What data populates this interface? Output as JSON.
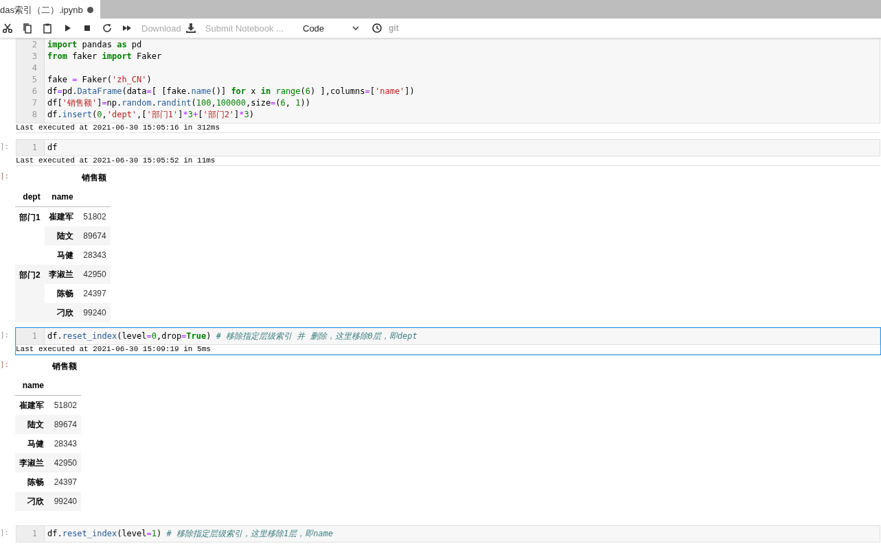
{
  "tab": {
    "title": "das索引（二）.ipynb",
    "unsaved": true
  },
  "toolbar": {
    "buttons": [
      {
        "kind": "cut"
      },
      {
        "kind": "copy"
      },
      {
        "kind": "paste"
      },
      {
        "kind": "run"
      },
      {
        "kind": "stop"
      },
      {
        "kind": "restart"
      },
      {
        "kind": "runall"
      }
    ],
    "download_label": "Download",
    "download_disabled": true,
    "submit_label": "Submit Notebook ...",
    "submit_disabled": true,
    "cell_type": "Code",
    "git_label": "git"
  },
  "cells": [
    {
      "selected": false,
      "lines": [
        {
          "number": "2",
          "tokens": [
            {
              "kind": "kw",
              "text": "import"
            },
            {
              "kind": "plain",
              "text": " pandas "
            },
            {
              "kind": "kw",
              "text": "as"
            },
            {
              "kind": "plain",
              "text": " pd"
            }
          ]
        },
        {
          "number": "3",
          "tokens": [
            {
              "kind": "kw",
              "text": "from"
            },
            {
              "kind": "plain",
              "text": " faker "
            },
            {
              "kind": "kw",
              "text": "import"
            },
            {
              "kind": "plain",
              "text": " Faker"
            }
          ]
        },
        {
          "number": "4"
        },
        {
          "number": "5",
          "tokens": [
            {
              "kind": "plain",
              "text": "fake "
            },
            {
              "kind": "op",
              "text": "="
            },
            {
              "kind": "plain",
              "text": " Faker("
            },
            {
              "kind": "str",
              "text": "'zh_CN'"
            },
            {
              "kind": "plain",
              "text": ")"
            }
          ]
        },
        {
          "number": "6",
          "tokens": [
            {
              "kind": "plain",
              "text": "df"
            },
            {
              "kind": "op",
              "text": "="
            },
            {
              "kind": "plain",
              "text": "pd."
            },
            {
              "kind": "prop",
              "text": "DataFrame"
            },
            {
              "kind": "plain",
              "text": "(data"
            },
            {
              "kind": "op",
              "text": "="
            },
            {
              "kind": "plain",
              "text": "[ [fake."
            },
            {
              "kind": "prop",
              "text": "name"
            },
            {
              "kind": "plain",
              "text": "()] "
            },
            {
              "kind": "kw",
              "text": "for"
            },
            {
              "kind": "plain",
              "text": " x "
            },
            {
              "kind": "kw",
              "text": "in"
            },
            {
              "kind": "builtin",
              "text": " range"
            },
            {
              "kind": "plain",
              "text": "("
            },
            {
              "kind": "num",
              "text": "6"
            },
            {
              "kind": "plain",
              "text": ") ],columns"
            },
            {
              "kind": "op",
              "text": "="
            },
            {
              "kind": "plain",
              "text": "["
            },
            {
              "kind": "str",
              "text": "'name'"
            },
            {
              "kind": "plain",
              "text": "])"
            }
          ]
        },
        {
          "number": "7",
          "tokens": [
            {
              "kind": "plain",
              "text": "df["
            },
            {
              "kind": "str",
              "text": "'销售额'"
            },
            {
              "kind": "plain",
              "text": "]"
            },
            {
              "kind": "op",
              "text": "="
            },
            {
              "kind": "plain",
              "text": "np."
            },
            {
              "kind": "prop",
              "text": "random"
            },
            {
              "kind": "plain",
              "text": "."
            },
            {
              "kind": "prop",
              "text": "randint"
            },
            {
              "kind": "plain",
              "text": "("
            },
            {
              "kind": "num",
              "text": "100"
            },
            {
              "kind": "plain",
              "text": ","
            },
            {
              "kind": "num",
              "text": "100000"
            },
            {
              "kind": "plain",
              "text": ",size"
            },
            {
              "kind": "op",
              "text": "="
            },
            {
              "kind": "plain",
              "text": "("
            },
            {
              "kind": "num",
              "text": "6"
            },
            {
              "kind": "plain",
              "text": ", "
            },
            {
              "kind": "num",
              "text": "1"
            },
            {
              "kind": "plain",
              "text": "))"
            }
          ]
        },
        {
          "number": "8",
          "tokens": [
            {
              "kind": "plain",
              "text": "df."
            },
            {
              "kind": "prop",
              "text": "insert"
            },
            {
              "kind": "plain",
              "text": "("
            },
            {
              "kind": "num",
              "text": "0"
            },
            {
              "kind": "plain",
              "text": ","
            },
            {
              "kind": "str",
              "text": "'dept'"
            },
            {
              "kind": "plain",
              "text": ",["
            },
            {
              "kind": "str",
              "text": "'部门1'"
            },
            {
              "kind": "plain",
              "text": "]"
            },
            {
              "kind": "op",
              "text": "*"
            },
            {
              "kind": "num",
              "text": "3"
            },
            {
              "kind": "op",
              "text": "+"
            },
            {
              "kind": "plain",
              "text": "["
            },
            {
              "kind": "str",
              "text": "'部门2'"
            },
            {
              "kind": "plain",
              "text": "]"
            },
            {
              "kind": "op",
              "text": "*"
            },
            {
              "kind": "num",
              "text": "3"
            },
            {
              "kind": "plain",
              "text": ")"
            }
          ]
        }
      ],
      "exec_info": "Last executed at 2021-06-30 15:05:16 in 312ms"
    },
    {
      "prompt": "]:",
      "selected": false,
      "lines": [
        {
          "number": "1",
          "tokens": [
            {
              "kind": "plain",
              "text": "df"
            }
          ]
        }
      ],
      "exec_info": "Last executed at 2021-06-30 15:05:52 in 11ms",
      "output": {
        "prompt": "]:",
        "column_header": "销售额",
        "index_names": [
          "dept",
          "name"
        ],
        "groups": [
          {
            "label": "部门1",
            "rows": [
              {
                "name": "崔建军",
                "value": "51802"
              },
              {
                "name": "陆文",
                "value": "89674"
              },
              {
                "name": "马健",
                "value": "28343"
              }
            ]
          },
          {
            "label": "部门2",
            "rows": [
              {
                "name": "李淑兰",
                "value": "42950"
              },
              {
                "name": "陈畅",
                "value": "24397"
              },
              {
                "name": "刁欣",
                "value": "99240"
              }
            ]
          }
        ]
      }
    },
    {
      "prompt": "]:",
      "selected": true,
      "lines": [
        {
          "number": "1",
          "tokens": [
            {
              "kind": "plain",
              "text": "df."
            },
            {
              "kind": "prop",
              "text": "reset_index"
            },
            {
              "kind": "plain",
              "text": "(level"
            },
            {
              "kind": "op",
              "text": "="
            },
            {
              "kind": "num",
              "text": "0"
            },
            {
              "kind": "plain",
              "text": ",drop"
            },
            {
              "kind": "op",
              "text": "="
            },
            {
              "kind": "kw",
              "text": "True"
            },
            {
              "kind": "plain",
              "text": ") "
            },
            {
              "kind": "cm",
              "text": "# 移除指定层级索引 并 删除，这里移除0层，即dept"
            }
          ]
        }
      ],
      "exec_info": "Last executed at 2021-06-30 15:09:19 in 5ms",
      "output": {
        "prompt": "]:",
        "column_header": "销售额",
        "index_names": [
          "name"
        ],
        "groups": [
          {
            "rows": [
              {
                "name": "崔建军",
                "value": "51802"
              },
              {
                "name": "陆文",
                "value": "89674"
              },
              {
                "name": "马健",
                "value": "28343"
              },
              {
                "name": "李淑兰",
                "value": "42950"
              },
              {
                "name": "陈畅",
                "value": "24397"
              },
              {
                "name": "刁欣",
                "value": "99240"
              }
            ]
          }
        ]
      }
    },
    {
      "prompt": "]:",
      "selected": false,
      "lines": [
        {
          "number": "1",
          "tokens": [
            {
              "kind": "plain",
              "text": "df."
            },
            {
              "kind": "prop",
              "text": "reset_index"
            },
            {
              "kind": "plain",
              "text": "(level"
            },
            {
              "kind": "op",
              "text": "="
            },
            {
              "kind": "num",
              "text": "1"
            },
            {
              "kind": "plain",
              "text": ") "
            },
            {
              "kind": "cm",
              "text": "# 移除指定层级索引，这里移除1层，即name"
            }
          ]
        }
      ]
    }
  ]
}
